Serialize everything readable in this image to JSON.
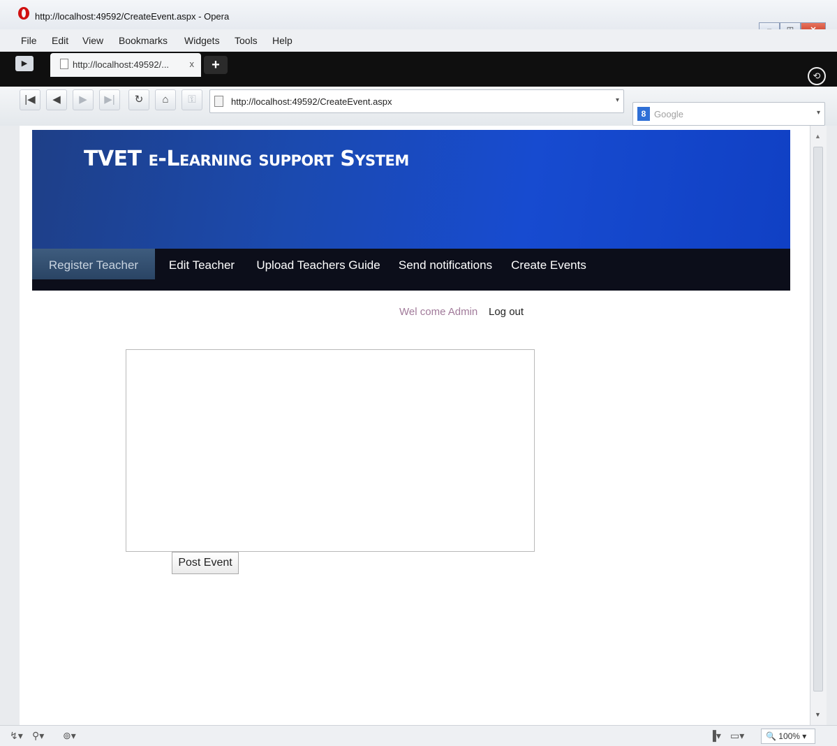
{
  "window": {
    "title": "http://localhost:49592/CreateEvent.aspx - Opera",
    "minimize": "–",
    "maximize": "◫",
    "close": "✕"
  },
  "menubar": [
    "File",
    "Edit",
    "View",
    "Bookmarks",
    "Widgets",
    "Tools",
    "Help"
  ],
  "tabs": {
    "panel_toggle": "▶",
    "active_title": "http://localhost:49592/...",
    "close": "x",
    "new_tab": "+",
    "trash": "⟲"
  },
  "toolbar": {
    "rewind": "|◀",
    "back": "◀",
    "forward": "▶",
    "fast_forward": "▶|",
    "reload": "↻",
    "home": "⌂",
    "key": "⚿",
    "address": "http://localhost:49592/CreateEvent.aspx",
    "address_drop": "▾",
    "search_engine": "8",
    "search_placeholder": "Google",
    "search_drop": "▾"
  },
  "site": {
    "title": "TVET e-Learning support System",
    "menu": [
      "Register Teacher",
      "Edit Teacher",
      "Upload Teachers Guide",
      "Send notifications",
      "Create Events"
    ],
    "welcome": "Wel come Admin",
    "logout": "Log out",
    "textarea_value": "",
    "post_button": "Post Event"
  },
  "statusbar": {
    "left_icons": [
      "↯▾",
      "⚲▾",
      "⊚▾"
    ],
    "right_icons": [
      "▐▾",
      "▭▾"
    ],
    "zoom": "🔍 100%  ▾"
  },
  "colors": {
    "banner": "#1b4ab0",
    "menu_bg": "#0c0e1a",
    "active_menu": "#3e5c7e",
    "welcome_text": "#a17a9a"
  }
}
